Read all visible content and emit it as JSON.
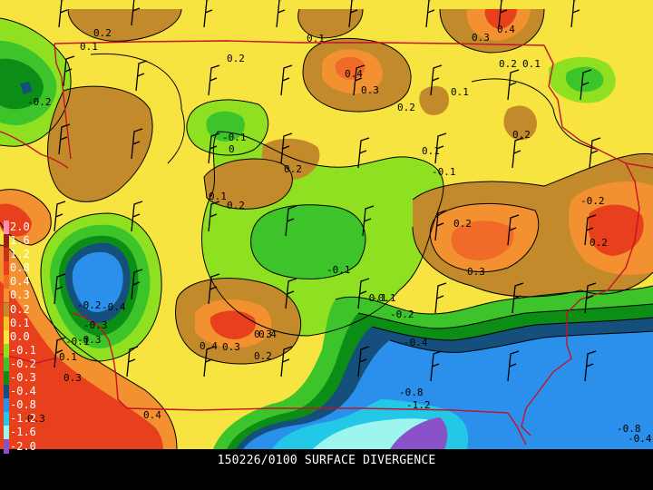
{
  "caption": "150226/0100 SURFACE DIVERGENCE",
  "legend": [
    {
      "label": "2.0",
      "color": "#ff8fb0"
    },
    {
      "label": "1.6",
      "color": "#9a2018"
    },
    {
      "label": "1.2",
      "color": "#c8301c"
    },
    {
      "label": "0.8",
      "color": "#e8401c"
    },
    {
      "label": "0.4",
      "color": "#f06a28"
    },
    {
      "label": "0.3",
      "color": "#f39030"
    },
    {
      "label": "0.2",
      "color": "#c28a2a"
    },
    {
      "label": "0.1",
      "color": "#f8c020"
    },
    {
      "label": "0.0",
      "color": "#f8e440"
    },
    {
      "label": "-0.1",
      "color": "#8ee020"
    },
    {
      "label": "-0.2",
      "color": "#3cc42a"
    },
    {
      "label": "-0.3",
      "color": "#0c8e16"
    },
    {
      "label": "-0.4",
      "color": "#15507c"
    },
    {
      "label": "-0.8",
      "color": "#2a90ec"
    },
    {
      "label": "-1.2",
      "color": "#22c8e6"
    },
    {
      "label": "-1.6",
      "color": "#9ef4ee"
    },
    {
      "label": "-2.0",
      "color": "#8a52c8"
    }
  ],
  "contour_labels": [
    "0.2",
    "0.1",
    "0.2",
    "0.1",
    "0.3",
    "0.4",
    "0.1",
    "0.2",
    "0.4",
    "0.3",
    "0.1",
    "-0.2",
    "0.2",
    "0.1",
    "0.2",
    "-0.1",
    "0",
    "0.2",
    "0.1",
    "-0.1",
    "0.2",
    "-0.2",
    "-0.1",
    "-0.2",
    "0.3",
    "0.2",
    "0.4",
    "0.3",
    "-0.1",
    "-0.2",
    "-0.4",
    "-0.3",
    "-0.1",
    "-0.4",
    "-0.3",
    "0.2",
    "-0.1",
    "0.4",
    "0.3",
    "0.2",
    "-0.8",
    "-1.2",
    "0.1",
    "0.3",
    "0.4",
    "0.3",
    "-0.8",
    "-0.4"
  ]
}
